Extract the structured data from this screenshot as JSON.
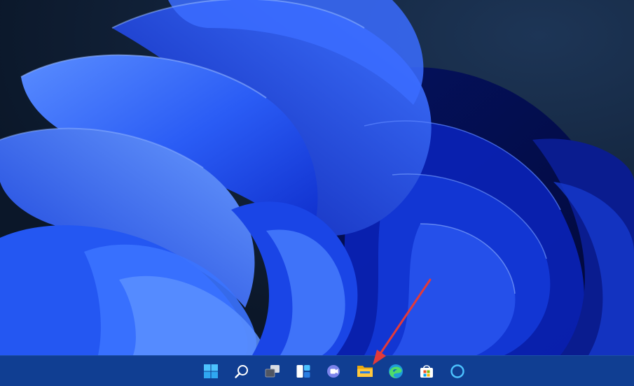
{
  "desktop": {
    "wallpaper": "windows-11-bloom",
    "colors": {
      "background": "#0c1a2f",
      "petal_dark": "#0a2ad6",
      "petal_mid": "#1f48f2",
      "petal_light": "#4f86ff"
    }
  },
  "taskbar": {
    "background": "#103e92",
    "items": [
      {
        "name": "start-button",
        "icon": "windows-logo-icon"
      },
      {
        "name": "search-button",
        "icon": "search-icon"
      },
      {
        "name": "task-view-button",
        "icon": "task-view-icon"
      },
      {
        "name": "widgets-button",
        "icon": "widgets-icon"
      },
      {
        "name": "chat-button",
        "icon": "teams-chat-icon"
      },
      {
        "name": "file-explorer-button",
        "icon": "file-explorer-icon"
      },
      {
        "name": "edge-button",
        "icon": "edge-icon"
      },
      {
        "name": "store-button",
        "icon": "microsoft-store-icon"
      },
      {
        "name": "cortana-button",
        "icon": "cortana-icon"
      }
    ]
  },
  "annotation": {
    "type": "arrow",
    "color": "#e23a3a",
    "points_to": "file-explorer-button"
  }
}
